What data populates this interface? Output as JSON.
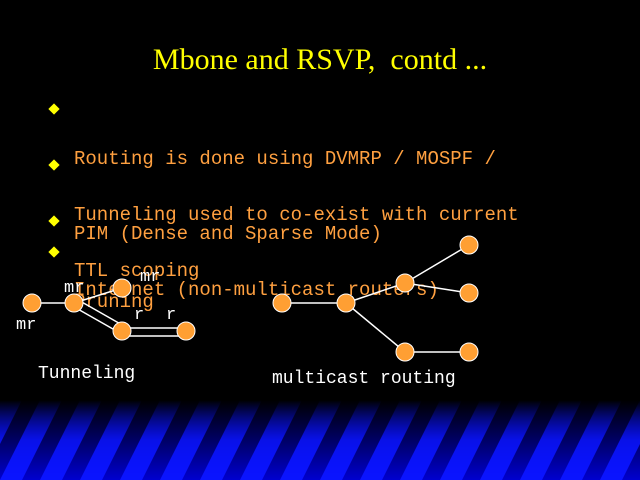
{
  "title": "Mbone and RSVP,  contd ...",
  "bullets": [
    {
      "lines": [
        "Routing is done using DVMRP / MOSPF /",
        "PIM (Dense and Sparse Mode)"
      ]
    },
    {
      "lines": [
        "Tunneling used to co-exist with current",
        "Internet (non-multicast routers)"
      ]
    },
    {
      "lines": [
        "TTL scoping"
      ]
    },
    {
      "lines": [
        "Pruning"
      ]
    }
  ],
  "tunneling_diagram": {
    "caption": "Tunneling",
    "labels": {
      "mr_left": "mr",
      "mr_top": "mr",
      "mr_right": "mr",
      "r_left": "r",
      "r_right": "r"
    }
  },
  "multicast_diagram": {
    "caption": "multicast routing"
  },
  "colors": {
    "background": "#000000",
    "title": "#ffff00",
    "bullet_text": "#ffa040",
    "bullet_mark": "#ffff00",
    "node_fill": "#ff9f33",
    "node_stroke": "#ffffff",
    "edge": "#ffffff",
    "footer_blue": "#0a14ff"
  }
}
